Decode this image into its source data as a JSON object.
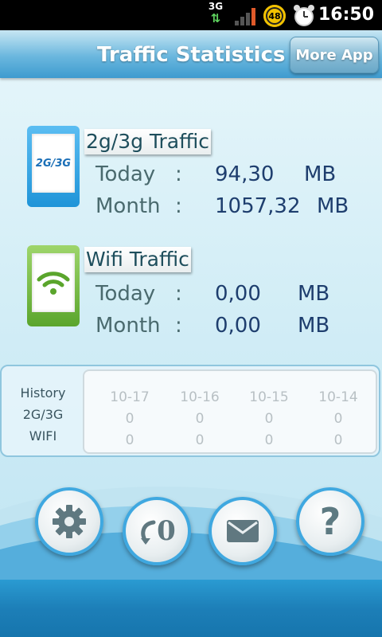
{
  "status_bar": {
    "network": "3G",
    "battery": "48",
    "time": "16:50"
  },
  "header": {
    "title": "Traffic Statistics",
    "more_app": "More App"
  },
  "cell_traffic": {
    "icon_text": "2G/3G",
    "title": "2g/3g Traffic",
    "today_label": "Today",
    "today_value": "94,30",
    "today_unit": "MB",
    "month_label": "Month",
    "month_value": "1057,32",
    "month_unit": "MB",
    "colon": ":"
  },
  "wifi_traffic": {
    "title": "Wifi   Traffic",
    "today_label": "Today",
    "today_value": "0,00",
    "today_unit": "MB",
    "month_label": "Month",
    "month_value": "0,00",
    "month_unit": "MB",
    "colon": ":"
  },
  "history": {
    "labels": [
      "History",
      "2G/3G",
      "WIFI"
    ],
    "columns": [
      {
        "date": "10-17",
        "cell": "0",
        "wifi": "0"
      },
      {
        "date": "10-16",
        "cell": "0",
        "wifi": "0"
      },
      {
        "date": "10-15",
        "cell": "0",
        "wifi": "0"
      },
      {
        "date": "10-14",
        "cell": "0",
        "wifi": "0"
      }
    ]
  },
  "buttons": {
    "reset_text": "0",
    "help_text": "?"
  },
  "icons": {
    "settings": "gear-icon",
    "reset": "reset-icon",
    "mail": "mail-icon",
    "help": "help-icon"
  },
  "colors": {
    "header_blue": "#3e9bcf",
    "button_border": "#3fa8e0",
    "cell_icon": "#1f94d8",
    "wifi_icon": "#5aa52c"
  }
}
